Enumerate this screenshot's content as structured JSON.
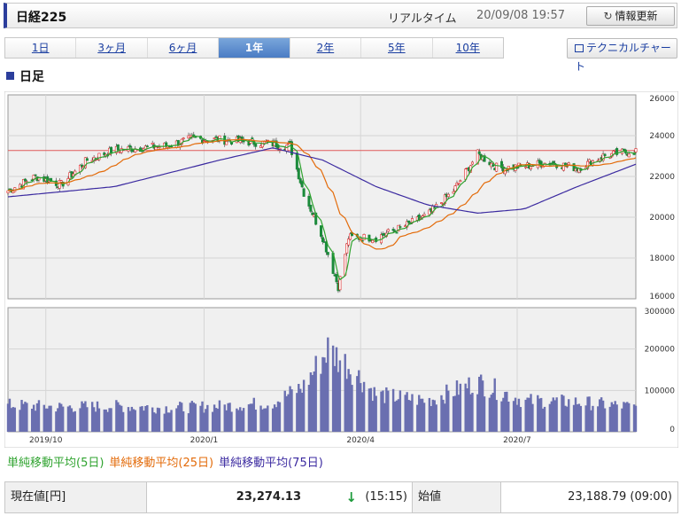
{
  "header": {
    "title": "日経225",
    "realtime_label": "リアルタイム",
    "timestamp": "20/09/08 19:57",
    "refresh_label": "情報更新",
    "refresh_icon": "refresh-icon"
  },
  "tabs": [
    {
      "label": "1日",
      "active": false
    },
    {
      "label": "3ヶ月",
      "active": false
    },
    {
      "label": "6ヶ月",
      "active": false
    },
    {
      "label": "1年",
      "active": true
    },
    {
      "label": "2年",
      "active": false
    },
    {
      "label": "5年",
      "active": false
    },
    {
      "label": "10年",
      "active": false
    }
  ],
  "tech_chart_label": "テクニカルチャート",
  "section_title": "日足",
  "legend": {
    "ma5": "単純移動平均(5日)",
    "ma25": "単純移動平均(25日)",
    "ma75": "単純移動平均(75日)"
  },
  "colors": {
    "ma5": "#2fa32f",
    "ma25": "#e36b0a",
    "ma75": "#3b2aa0",
    "up": "#e02020",
    "down": "#1a8a3a",
    "volume": "#6a6fb0",
    "current_line": "#e05a5a",
    "accent": "#2c3e9c"
  },
  "quote": {
    "current_label": "現在値[円]",
    "current_value": "23,274.13",
    "direction": "down",
    "current_time": "(15:15)",
    "open_label": "始値",
    "open_value": "23,188.79 (09:00)"
  },
  "chart_data": {
    "type": "candlestick",
    "price_axis": {
      "ticks": [
        "26000",
        "24000",
        "22000",
        "20000",
        "18000",
        "16000"
      ],
      "ylim": [
        16000,
        26000
      ]
    },
    "volume_axis": {
      "ticks": [
        "300000",
        "200000",
        "100000",
        "0"
      ],
      "ylim": [
        0,
        300000
      ]
    },
    "x_ticks": [
      "2019/10",
      "2020/1",
      "2020/4",
      "2020/7"
    ],
    "current_price": 23274.13,
    "grid": true,
    "price_path": [
      {
        "date": "2019/09/09",
        "value": 21300
      },
      {
        "date": "2019/09/25",
        "value": 22000
      },
      {
        "date": "2019/10/10",
        "value": 21600
      },
      {
        "date": "2019/10/25",
        "value": 22800
      },
      {
        "date": "2019/11/10",
        "value": 23300
      },
      {
        "date": "2019/11/25",
        "value": 23400
      },
      {
        "date": "2019/12/10",
        "value": 23500
      },
      {
        "date": "2019/12/25",
        "value": 23850
      },
      {
        "date": "2020/01/10",
        "value": 23800
      },
      {
        "date": "2020/01/25",
        "value": 23700
      },
      {
        "date": "2020/02/10",
        "value": 23600
      },
      {
        "date": "2020/02/20",
        "value": 23500
      },
      {
        "date": "2020/02/28",
        "value": 21200
      },
      {
        "date": "2020/03/10",
        "value": 19000
      },
      {
        "date": "2020/03/19",
        "value": 16600
      },
      {
        "date": "2020/03/25",
        "value": 19000
      },
      {
        "date": "2020/04/10",
        "value": 19000
      },
      {
        "date": "2020/04/25",
        "value": 19500
      },
      {
        "date": "2020/05/10",
        "value": 20100
      },
      {
        "date": "2020/05/25",
        "value": 21300
      },
      {
        "date": "2020/06/08",
        "value": 23100
      },
      {
        "date": "2020/06/20",
        "value": 22400
      },
      {
        "date": "2020/07/05",
        "value": 22500
      },
      {
        "date": "2020/07/20",
        "value": 22700
      },
      {
        "date": "2020/08/05",
        "value": 22400
      },
      {
        "date": "2020/08/20",
        "value": 23000
      },
      {
        "date": "2020/09/08",
        "value": 23274
      }
    ],
    "ma75_path": [
      {
        "date": "2019/09/09",
        "value": 21000
      },
      {
        "date": "2019/11/10",
        "value": 21500
      },
      {
        "date": "2020/01/10",
        "value": 22800
      },
      {
        "date": "2020/02/10",
        "value": 23400
      },
      {
        "date": "2020/03/10",
        "value": 22800
      },
      {
        "date": "2020/04/10",
        "value": 21500
      },
      {
        "date": "2020/05/10",
        "value": 20600
      },
      {
        "date": "2020/06/08",
        "value": 20200
      },
      {
        "date": "2020/07/05",
        "value": 20400
      },
      {
        "date": "2020/08/05",
        "value": 21500
      },
      {
        "date": "2020/09/08",
        "value": 22600
      }
    ],
    "volume_path": [
      {
        "date": "2019/09/09",
        "value": 65000
      },
      {
        "date": "2019/10/10",
        "value": 60000
      },
      {
        "date": "2019/11/10",
        "value": 62000
      },
      {
        "date": "2019/12/10",
        "value": 58000
      },
      {
        "date": "2020/01/10",
        "value": 62000
      },
      {
        "date": "2020/02/10",
        "value": 70000
      },
      {
        "date": "2020/02/28",
        "value": 110000
      },
      {
        "date": "2020/03/13",
        "value": 200000
      },
      {
        "date": "2020/03/25",
        "value": 160000
      },
      {
        "date": "2020/04/10",
        "value": 90000
      },
      {
        "date": "2020/05/10",
        "value": 75000
      },
      {
        "date": "2020/06/08",
        "value": 120000
      },
      {
        "date": "2020/07/05",
        "value": 75000
      },
      {
        "date": "2020/08/05",
        "value": 72000
      },
      {
        "date": "2020/09/08",
        "value": 60000
      }
    ]
  }
}
